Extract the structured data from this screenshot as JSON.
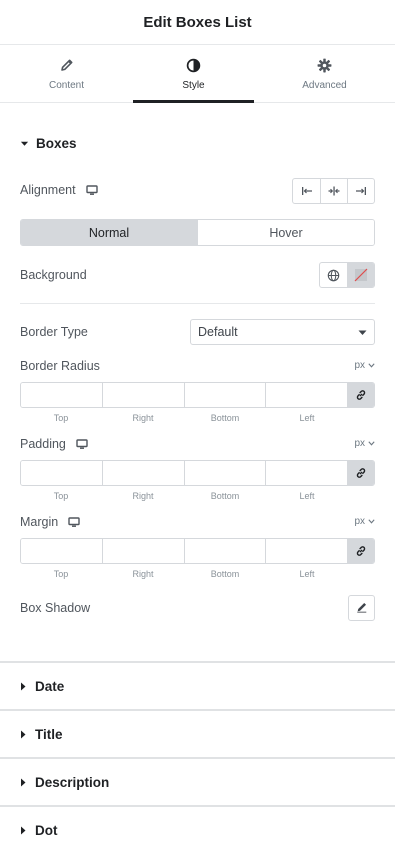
{
  "panel": {
    "title": "Edit Boxes List"
  },
  "tabs": [
    {
      "label": "Content",
      "icon": "pencil-icon"
    },
    {
      "label": "Style",
      "icon": "contrast-icon",
      "active": true
    },
    {
      "label": "Advanced",
      "icon": "gear-icon"
    }
  ],
  "boxes": {
    "title": "Boxes",
    "alignment": {
      "label": "Alignment",
      "options": [
        "align-start-icon",
        "align-center-icon",
        "align-end-icon"
      ]
    },
    "state_toggle": {
      "normal": "Normal",
      "hover": "Hover",
      "selected": "Normal"
    },
    "background": {
      "label": "Background"
    },
    "border_type": {
      "label": "Border Type",
      "value": "Default"
    },
    "border_radius": {
      "label": "Border Radius",
      "unit": "px",
      "values": {
        "top": "",
        "right": "",
        "bottom": "",
        "left": ""
      }
    },
    "padding": {
      "label": "Padding",
      "unit": "px",
      "values": {
        "top": "",
        "right": "",
        "bottom": "",
        "left": ""
      }
    },
    "margin": {
      "label": "Margin",
      "unit": "px",
      "values": {
        "top": "",
        "right": "",
        "bottom": "",
        "left": ""
      }
    },
    "dimension_labels": {
      "top": "Top",
      "right": "Right",
      "bottom": "Bottom",
      "left": "Left"
    },
    "box_shadow": {
      "label": "Box Shadow"
    }
  },
  "sections": [
    {
      "title": "Date"
    },
    {
      "title": "Title"
    },
    {
      "title": "Description"
    },
    {
      "title": "Dot"
    }
  ],
  "colors": {
    "accent": "#1f2124",
    "border": "#d5d8dc",
    "muted": "#6d7882",
    "no_color_slash": "#e04b4b"
  }
}
